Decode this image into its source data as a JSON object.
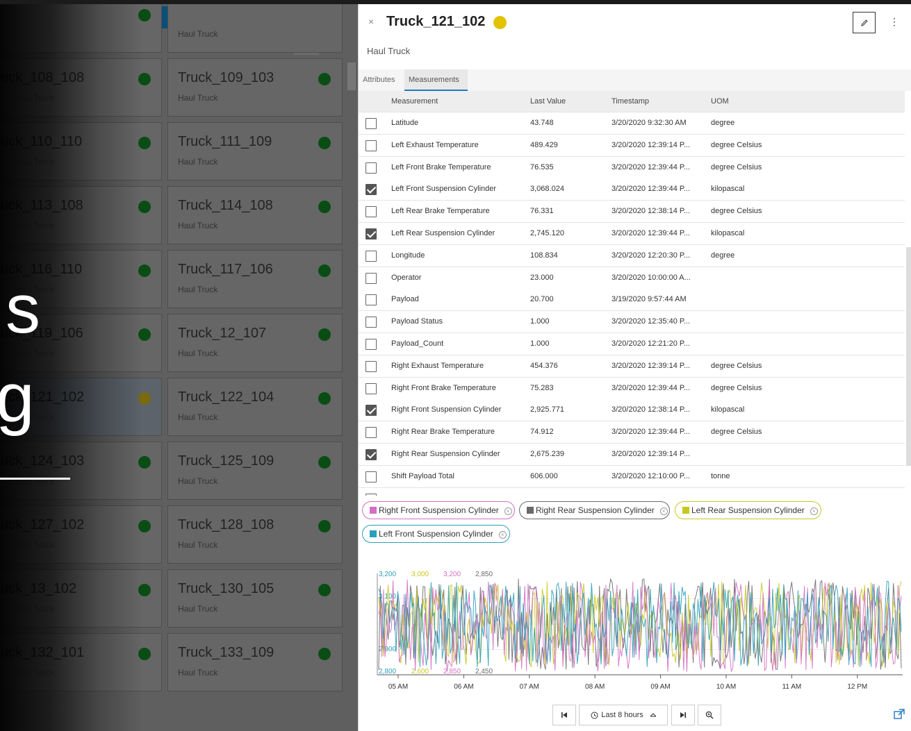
{
  "left_list": {
    "clear_label": "×",
    "add_label": "+",
    "more_label": "⋮",
    "left_cards": [
      {
        "title": "",
        "subtitle": "",
        "status": "green"
      },
      {
        "title": "uck_108_108",
        "subtitle": "Haul Truck",
        "status": "green"
      },
      {
        "title": "uck_110_110",
        "subtitle": "Haul Truck",
        "status": "green"
      },
      {
        "title": "uck_113_108",
        "subtitle": "Haul Truck",
        "status": "green"
      },
      {
        "title": "uck_116_110",
        "subtitle": "Haul Truck",
        "status": "green"
      },
      {
        "title": "uck_119_106",
        "subtitle": "Haul Truck",
        "status": "green"
      },
      {
        "title": "uck_121_102",
        "subtitle": "Haul Truck",
        "status": "yellow"
      },
      {
        "title": "uck_124_103",
        "subtitle": "Haul Truck",
        "status": "green"
      },
      {
        "title": "uck_127_102",
        "subtitle": "Haul Truck",
        "status": "green"
      },
      {
        "title": "uck_13_102",
        "subtitle": "Haul Truck",
        "status": "green"
      },
      {
        "title": "uck_132_101",
        "subtitle": "Haul Truck",
        "status": "green"
      }
    ],
    "right_cards": [
      {
        "title": "",
        "subtitle": "Haul Truck",
        "status": "none"
      },
      {
        "title": "Truck_109_103",
        "subtitle": "Haul Truck",
        "status": "green"
      },
      {
        "title": "Truck_111_109",
        "subtitle": "Haul Truck",
        "status": "green"
      },
      {
        "title": "Truck_114_108",
        "subtitle": "Haul Truck",
        "status": "green"
      },
      {
        "title": "Truck_117_106",
        "subtitle": "Haul Truck",
        "status": "green"
      },
      {
        "title": "Truck_12_107",
        "subtitle": "Haul Truck",
        "status": "green"
      },
      {
        "title": "Truck_122_104",
        "subtitle": "Haul Truck",
        "status": "green"
      },
      {
        "title": "Truck_125_109",
        "subtitle": "Haul Truck",
        "status": "green"
      },
      {
        "title": "Truck_128_108",
        "subtitle": "Haul Truck",
        "status": "green"
      },
      {
        "title": "Truck_130_105",
        "subtitle": "Haul Truck",
        "status": "green"
      },
      {
        "title": "Truck_133_109",
        "subtitle": "Haul Truck",
        "status": "green"
      }
    ]
  },
  "overlay_text": {
    "line1": "s",
    "line2": "g"
  },
  "asset": {
    "title": "Truck_121_102",
    "subtitle": "Haul Truck",
    "status_color": "#e3c200",
    "close_label": "×",
    "more_label": "⋮"
  },
  "tabs": [
    "Attributes",
    "Measurements"
  ],
  "active_tab": "Measurements",
  "table": {
    "headers": [
      "Measurement",
      "Last Value",
      "Timestamp",
      "UOM"
    ],
    "rows": [
      {
        "checked": false,
        "name": "Latitude",
        "value": "43.748",
        "ts": "3/20/2020 9:32:30 AM",
        "uom": "degree"
      },
      {
        "checked": false,
        "name": "Left Exhaust Temperature",
        "value": "489.429",
        "ts": "3/20/2020 12:39:14 P...",
        "uom": "degree Celsius"
      },
      {
        "checked": false,
        "name": "Left Front Brake Temperature",
        "value": "76.535",
        "ts": "3/20/2020 12:39:44 P...",
        "uom": "degree Celsius"
      },
      {
        "checked": true,
        "name": "Left Front Suspension Cylinder",
        "value": "3,068.024",
        "ts": "3/20/2020 12:39:44 P...",
        "uom": "kilopascal"
      },
      {
        "checked": false,
        "name": "Left Rear Brake Temperature",
        "value": "76.331",
        "ts": "3/20/2020 12:38:14 P...",
        "uom": "degree Celsius"
      },
      {
        "checked": true,
        "name": "Left Rear Suspension Cylinder",
        "value": "2,745.120",
        "ts": "3/20/2020 12:39:44 P...",
        "uom": "kilopascal"
      },
      {
        "checked": false,
        "name": "Longitude",
        "value": "108.834",
        "ts": "3/20/2020 12:20:30 P...",
        "uom": "degree"
      },
      {
        "checked": false,
        "name": "Operator",
        "value": "23.000",
        "ts": "3/20/2020 10:00:00 A...",
        "uom": ""
      },
      {
        "checked": false,
        "name": "Payload",
        "value": "20.700",
        "ts": "3/19/2020 9:57:44 AM",
        "uom": ""
      },
      {
        "checked": false,
        "name": "Payload Status",
        "value": "1.000",
        "ts": "3/20/2020 12:35:40 P...",
        "uom": ""
      },
      {
        "checked": false,
        "name": "Payload_Count",
        "value": "1.000",
        "ts": "3/20/2020 12:21:20 P...",
        "uom": ""
      },
      {
        "checked": false,
        "name": "Right Exhaust Temperature",
        "value": "454.376",
        "ts": "3/20/2020 12:39:14 P...",
        "uom": "degree Celsius"
      },
      {
        "checked": false,
        "name": "Right Front Brake Temperature",
        "value": "75.283",
        "ts": "3/20/2020 12:39:44 P...",
        "uom": "degree Celsius"
      },
      {
        "checked": true,
        "name": "Right Front Suspension Cylinder",
        "value": "2,925.771",
        "ts": "3/20/2020 12:38:14 P...",
        "uom": "kilopascal"
      },
      {
        "checked": false,
        "name": "Right Rear Brake Temperature",
        "value": "74.912",
        "ts": "3/20/2020 12:39:44 P...",
        "uom": "degree Celsius"
      },
      {
        "checked": true,
        "name": "Right Rear Suspension Cylinder",
        "value": "2,675.239",
        "ts": "3/20/2020 12:39:14 P...",
        "uom": ""
      },
      {
        "checked": false,
        "name": "Shift Payload Total",
        "value": "606.000",
        "ts": "3/20/2020 12:10:00 P...",
        "uom": "tonne"
      }
    ]
  },
  "chips": [
    {
      "label": "Right Front Suspension Cylinder",
      "color": "#d46fc3"
    },
    {
      "label": "Right Rear Suspension Cylinder",
      "color": "#6a6a6a"
    },
    {
      "label": "Left Rear Suspension Cylinder",
      "color": "#c8c81e"
    },
    {
      "label": "Left Front Suspension Cylinder",
      "color": "#2aa0b8"
    }
  ],
  "chart_data": {
    "type": "line",
    "x_ticks": [
      "05 AM",
      "06 AM",
      "07 AM",
      "08 AM",
      "09 AM",
      "10 AM",
      "11 AM",
      "12 PM"
    ],
    "axes": [
      {
        "series": "Left Front Suspension Cylinder",
        "color": "#2aa0b8",
        "ticks": [
          "3,200",
          "3,100",
          "2,900",
          "2,800"
        ],
        "ylim": [
          2800,
          3200
        ]
      },
      {
        "series": "Left Rear Suspension Cylinder",
        "color": "#c8c81e",
        "ticks": [
          "3,000",
          "2,600"
        ],
        "ylim": [
          2600,
          3000
        ]
      },
      {
        "series": "Right Front Suspension Cylinder",
        "color": "#d46fc3",
        "ticks": [
          "3,200",
          "2,850"
        ],
        "ylim": [
          2850,
          3200
        ]
      },
      {
        "series": "Right Rear Suspension Cylinder",
        "color": "#6a6a6a",
        "ticks": [
          "2,850",
          "2,450"
        ],
        "ylim": [
          2450,
          2850
        ]
      }
    ],
    "series": [
      {
        "name": "Left Front Suspension Cylinder",
        "color": "#2aa0b8",
        "approx_mean": 3000,
        "approx_range": [
          2840,
          3180
        ]
      },
      {
        "name": "Left Rear Suspension Cylinder",
        "color": "#c8c81e",
        "approx_mean": 2800,
        "approx_range": [
          2640,
          2980
        ]
      },
      {
        "name": "Right Front Suspension Cylinder",
        "color": "#d46fc3",
        "approx_mean": 3020,
        "approx_range": [
          2870,
          3190
        ]
      },
      {
        "name": "Right Rear Suspension Cylinder",
        "color": "#6a6a6a",
        "approx_mean": 2650,
        "approx_range": [
          2470,
          2830
        ]
      }
    ],
    "grid": true
  },
  "controls": {
    "time_range": "Last 8 hours"
  }
}
